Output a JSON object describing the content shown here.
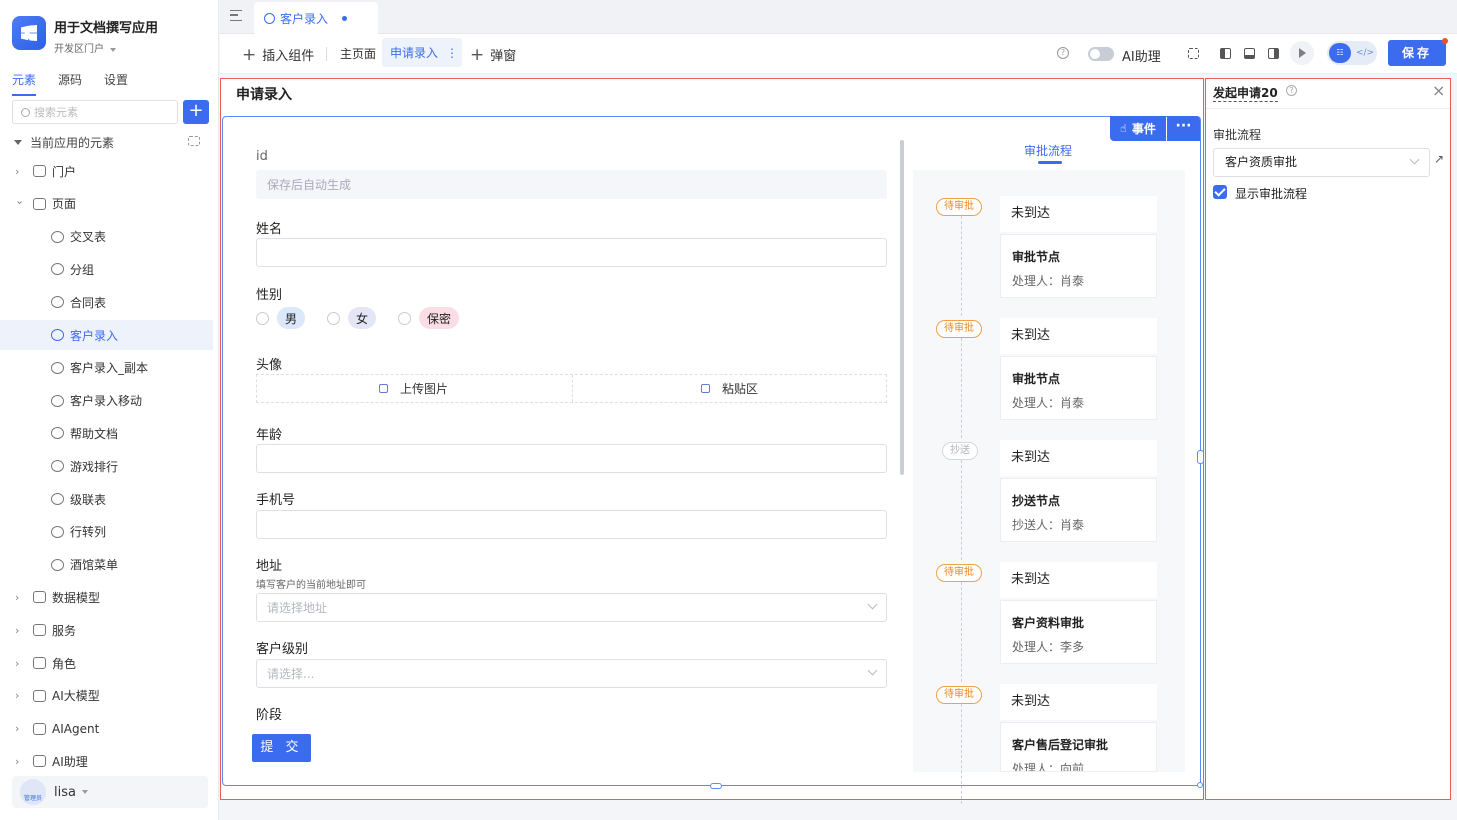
{
  "app": {
    "name": "用于文档撰写应用",
    "subtitle": "开发区门户"
  },
  "sidebar": {
    "tabs": [
      "元素",
      "源码",
      "设置"
    ],
    "search_placeholder": "搜索元素",
    "add_label": "+",
    "tree_header": "当前应用的元素",
    "items": [
      {
        "label": "门户",
        "level": 0,
        "expand": ">"
      },
      {
        "label": "页面",
        "level": 0,
        "expand": "v"
      },
      {
        "label": "交叉表",
        "level": 1
      },
      {
        "label": "分组",
        "level": 1
      },
      {
        "label": "合同表",
        "level": 1
      },
      {
        "label": "客户录入",
        "level": 1,
        "selected": true
      },
      {
        "label": "客户录入_副本",
        "level": 1
      },
      {
        "label": "客户录入移动",
        "level": 1
      },
      {
        "label": "帮助文档",
        "level": 1
      },
      {
        "label": "游戏排行",
        "level": 1
      },
      {
        "label": "级联表",
        "level": 1
      },
      {
        "label": "行转列",
        "level": 1
      },
      {
        "label": "酒馆菜单",
        "level": 1
      },
      {
        "label": "数据模型",
        "level": 0,
        "expand": ">"
      },
      {
        "label": "服务",
        "level": 0,
        "expand": ">"
      },
      {
        "label": "角色",
        "level": 0,
        "expand": ">"
      },
      {
        "label": "AI大模型",
        "level": 0,
        "expand": ">"
      },
      {
        "label": "AIAgent",
        "level": 0,
        "expand": ">"
      },
      {
        "label": "AI助理",
        "level": 0,
        "expand": ">"
      }
    ],
    "user": {
      "name": "lisa",
      "role": "管理员"
    }
  },
  "tabstrip": {
    "active_tab": "客户录入"
  },
  "toolbar": {
    "insert": "插入组件",
    "home": "主页面",
    "current": "申请录入",
    "current_more": "⋮",
    "popup": "弹窗",
    "ai_assistant": "AI助理",
    "save": "保存",
    "mode_a": "☷",
    "mode_b": "</>"
  },
  "canvas": {
    "page_title": "申请录入",
    "event_btn": "事件",
    "more_btn": "···",
    "fields": {
      "id_label": "id",
      "id_placeholder": "保存后自动生成",
      "name_label": "姓名",
      "gender_label": "性别",
      "gender_options": [
        "男",
        "女",
        "保密"
      ],
      "avatar_label": "头像",
      "upload": "上传图片",
      "paste": "粘贴区",
      "age_label": "年龄",
      "phone_label": "手机号",
      "address_label": "地址",
      "address_help": "填写客户的当前地址即可",
      "address_placeholder": "请选择地址",
      "level_label": "客户级别",
      "level_placeholder": "请选择...",
      "stage_label": "阶段"
    },
    "submit": "提 交"
  },
  "flow": {
    "title": "审批流程",
    "steps": [
      {
        "badge": "待审批",
        "kind": "wait",
        "status": "未到达",
        "node": "审批节点",
        "handler": "处理人：肖泰"
      },
      {
        "badge": "待审批",
        "kind": "wait",
        "status": "未到达",
        "node": "审批节点",
        "handler": "处理人：肖泰"
      },
      {
        "badge": "抄送",
        "kind": "cc",
        "status": "未到达",
        "node": "抄送节点",
        "handler": "抄送人：肖泰"
      },
      {
        "badge": "待审批",
        "kind": "wait",
        "status": "未到达",
        "node": "客户资料审批",
        "handler": "处理人：李多"
      },
      {
        "badge": "待审批",
        "kind": "wait",
        "status": "未到达",
        "node": "客户售后登记审批",
        "handler": "处理人：向前"
      }
    ]
  },
  "props": {
    "title": "发起申请20",
    "flow_label": "审批流程",
    "flow_value": "客户资质审批",
    "link_icon": "↗",
    "show_flow": "显示审批流程"
  },
  "colors": {
    "accent": "#3b6cf0",
    "selection_outline": "#ef5a5a",
    "wait": "#e8871e"
  }
}
